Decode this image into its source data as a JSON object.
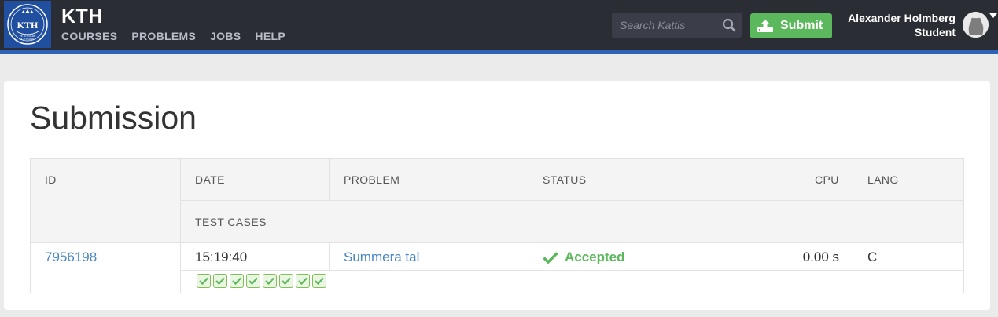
{
  "header": {
    "brand": "KTH",
    "logo_icon": "kth-crest-logo",
    "nav": [
      "COURSES",
      "PROBLEMS",
      "JOBS",
      "HELP"
    ],
    "search_placeholder": "Search Kattis",
    "submit_label": "Submit",
    "user_name": "Alexander Holmberg",
    "user_role": "Student"
  },
  "page": {
    "title": "Submission"
  },
  "table": {
    "headers": {
      "id": "ID",
      "date": "DATE",
      "problem": "PROBLEM",
      "status": "STATUS",
      "cpu": "CPU",
      "lang": "LANG",
      "test_cases": "TEST CASES"
    },
    "row": {
      "id": "7956198",
      "date": "15:19:40",
      "problem": "Summera tal",
      "status": "Accepted",
      "cpu": "0.00 s",
      "lang": "C",
      "test_cases_passed": 8
    }
  },
  "colors": {
    "header_bg": "#2b2d35",
    "accent_blue": "#2e63b8",
    "success": "#5cb85c",
    "link": "#4a86c5"
  }
}
